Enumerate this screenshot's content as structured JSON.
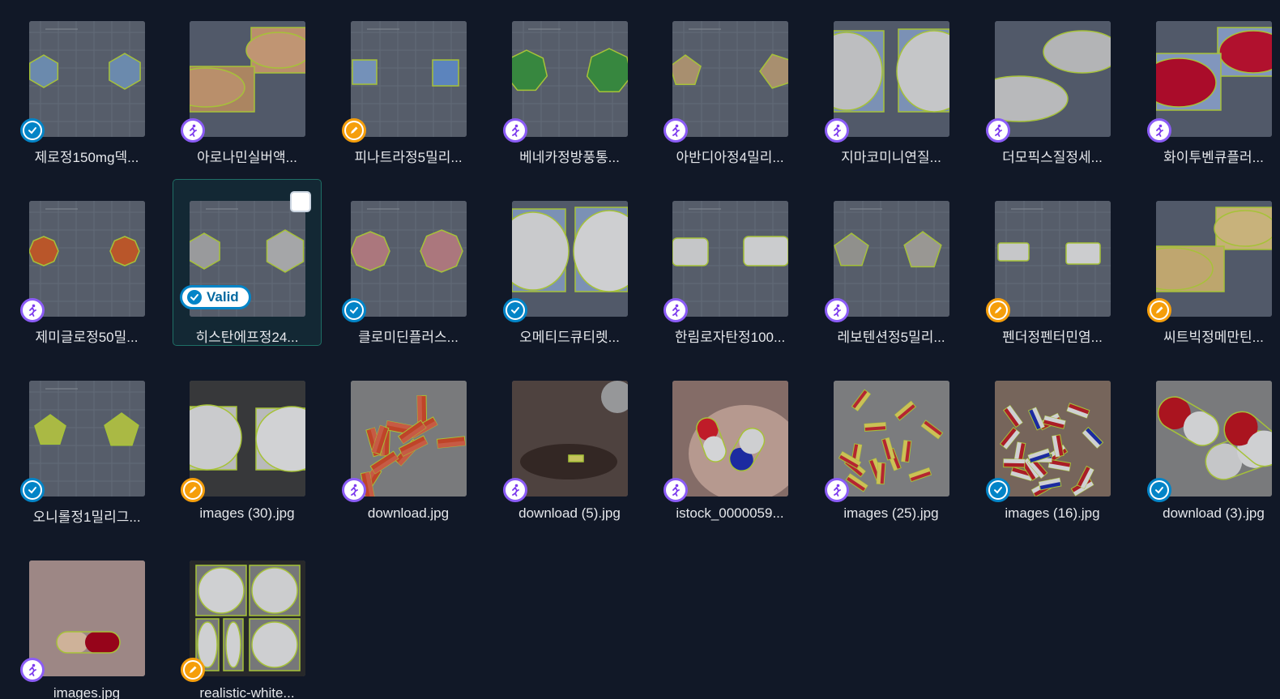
{
  "colors": {
    "background": "#111827",
    "badge_run": "#8b5cf6",
    "badge_valid": "#0284c7",
    "badge_review": "#f59e0b",
    "annotation_outline": "#c3e33c",
    "selection": "#1f6f66"
  },
  "gallery": {
    "items": [
      {
        "name": "제로정150mg덱...",
        "status": "valid",
        "status_icon": "shield-check-icon"
      },
      {
        "name": "아로나민실버액...",
        "status": "run",
        "status_icon": "running-person-icon"
      },
      {
        "name": "피나트라정5밀리...",
        "status": "review",
        "status_icon": "pencil-icon"
      },
      {
        "name": "베네카정방풍통...",
        "status": "run",
        "status_icon": "running-person-icon"
      },
      {
        "name": "아반디아정4밀리...",
        "status": "run",
        "status_icon": "running-person-icon"
      },
      {
        "name": "지마코미니연질...",
        "status": "run",
        "status_icon": "running-person-icon"
      },
      {
        "name": "더모픽스질정세...",
        "status": "run",
        "status_icon": "running-person-icon"
      },
      {
        "name": "화이투벤큐플러...",
        "status": "run",
        "status_icon": "running-person-icon"
      },
      {
        "name": "제미글로정50밀...",
        "status": "run",
        "status_icon": "running-person-icon"
      },
      {
        "name": "히스탄에프정24...",
        "status": "valid",
        "status_icon": "shield-check-icon",
        "selected": true,
        "status_label": "Valid"
      },
      {
        "name": "클로미딘플러스...",
        "status": "valid",
        "status_icon": "shield-check-icon"
      },
      {
        "name": "오메티드큐티렛...",
        "status": "valid",
        "status_icon": "shield-check-icon"
      },
      {
        "name": "한림로자탄정100...",
        "status": "run",
        "status_icon": "running-person-icon"
      },
      {
        "name": "레보텐션정5밀리...",
        "status": "run",
        "status_icon": "running-person-icon"
      },
      {
        "name": "펜더정펜터민염...",
        "status": "review",
        "status_icon": "pencil-icon"
      },
      {
        "name": "씨트빅정메만틴...",
        "status": "review",
        "status_icon": "pencil-icon"
      },
      {
        "name": "오니롤정1밀리그...",
        "status": "valid",
        "status_icon": "shield-check-icon"
      },
      {
        "name": "images (30).jpg",
        "status": "review",
        "status_icon": "pencil-icon"
      },
      {
        "name": "download.jpg",
        "status": "run",
        "status_icon": "running-person-icon"
      },
      {
        "name": "download (5).jpg",
        "status": "run",
        "status_icon": "running-person-icon"
      },
      {
        "name": "istock_0000059...",
        "status": "run",
        "status_icon": "running-person-icon"
      },
      {
        "name": "images (25).jpg",
        "status": "run",
        "status_icon": "running-person-icon"
      },
      {
        "name": "images (16).jpg",
        "status": "valid",
        "status_icon": "shield-check-icon"
      },
      {
        "name": "download (3).jpg",
        "status": "valid",
        "status_icon": "shield-check-icon"
      },
      {
        "name": "images.jpg",
        "status": "run",
        "status_icon": "running-person-icon"
      },
      {
        "name": "realistic-white...",
        "status": "review",
        "status_icon": "pencil-icon"
      }
    ]
  }
}
